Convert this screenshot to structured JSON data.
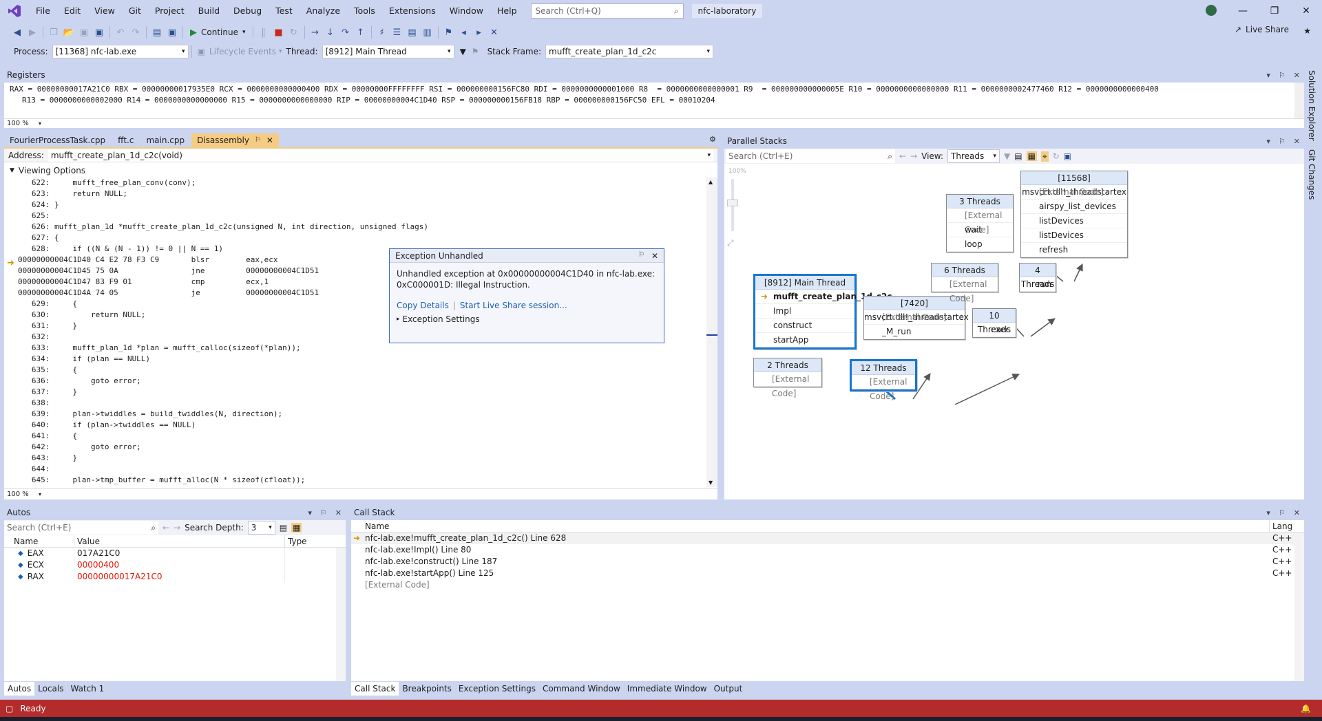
{
  "menu": [
    "File",
    "Edit",
    "View",
    "Git",
    "Project",
    "Build",
    "Debug",
    "Test",
    "Analyze",
    "Tools",
    "Extensions",
    "Window",
    "Help"
  ],
  "search_placeholder": "Search (Ctrl+Q)",
  "solution_name": "nfc-laboratory",
  "live_share": "Live Share",
  "toolbar": {
    "continue_label": "Continue"
  },
  "debug_bar": {
    "process_label": "Process:",
    "process_value": "[11368] nfc-lab.exe",
    "lifecycle_label": "Lifecycle Events",
    "thread_label": "Thread:",
    "thread_value": "[8912] Main Thread",
    "stack_frame_label": "Stack Frame:",
    "stack_frame_value": "mufft_create_plan_1d_c2c"
  },
  "registers": {
    "title": "Registers",
    "line1": "RAX = 00000000017A21C0 RBX = 00000000017935E0 RCX = 0000000000000400 RDX = 00000000FFFFFFFF RSI = 000000000156FC80 RDI = 0000000000001000 R8  = 0000000000000001 R9  = 000000000000005E R10 = 0000000000000000 R11 = 0000000002477460 R12 = 0000000000000400",
    "line2": "R13 = 0000000000002000 R14 = 0000000000000000 R15 = 0000000000000000 RIP = 00000000004C1D40 RSP = 000000000156FB18 RBP = 000000000156FC50 EFL = 00010204",
    "zoom": "100 %"
  },
  "doc_tabs": [
    "FourierProcessTask.cpp",
    "fft.c",
    "main.cpp",
    "Disassembly"
  ],
  "disassembly": {
    "address_label": "Address:",
    "address_value": "mufft_create_plan_1d_c2c(void)",
    "viewing_options": "Viewing Options",
    "zoom": "100 %",
    "lines": [
      "   622:     mufft_free_plan_conv(conv);",
      "   623:     return NULL;",
      "   624: }",
      "   625:",
      "   626: mufft_plan_1d *mufft_create_plan_1d_c2c(unsigned N, int direction, unsigned flags)",
      "   627: {",
      "   628:     if ((N & (N - 1)) != 0 || N == 1)",
      "00000000004C1D40 C4 E2 78 F3 C9       blsr        eax,ecx",
      "00000000004C1D45 75 0A                jne         00000000004C1D51",
      "00000000004C1D47 83 F9 01             cmp         ecx,1",
      "00000000004C1D4A 74 05                je          00000000004C1D51",
      "   629:     {",
      "   630:         return NULL;",
      "   631:     }",
      "   632:",
      "   633:     mufft_plan_1d *plan = mufft_calloc(sizeof(*plan));",
      "   634:     if (plan == NULL)",
      "   635:     {",
      "   636:         goto error;",
      "   637:     }",
      "   638:",
      "   639:     plan->twiddles = build_twiddles(N, direction);",
      "   640:     if (plan->twiddles == NULL)",
      "   641:     {",
      "   642:         goto error;",
      "   643:     }",
      "   644:",
      "   645:     plan->tmp_buffer = mufft_alloc(N * sizeof(cfloat));"
    ]
  },
  "exception": {
    "title": "Exception Unhandled",
    "message1": "Unhandled exception at 0x00000000004C1D40 in nfc-lab.exe:",
    "message2": "0xC000001D: Illegal Instruction.",
    "copy_details": "Copy Details",
    "live_share": "Start Live Share session...",
    "settings": "Exception Settings"
  },
  "parallel_stacks": {
    "title": "Parallel Stacks",
    "search_placeholder": "Search (Ctrl+E)",
    "view_label": "View:",
    "view_value": "Threads",
    "zoom_label": "100%",
    "nodes": {
      "main": {
        "header": "[8912] Main Thread",
        "rows": [
          "mufft_create_plan_1d_c2c",
          "Impl",
          "construct",
          "startApp"
        ]
      },
      "t2": {
        "header": "2 Threads",
        "rows": [
          "[External Code]"
        ]
      },
      "t12": {
        "header": "12 Threads",
        "rows": [
          "[External Code]"
        ]
      },
      "t7420": {
        "header": "[7420] msvcrt.dll!_threadstartex",
        "rows": [
          "[External Code]",
          "_M_run"
        ]
      },
      "t10": {
        "header": "10 Threads",
        "rows": [
          "exec"
        ]
      },
      "t6": {
        "header": "6 Threads",
        "rows": [
          "[External Code]"
        ]
      },
      "t4": {
        "header": "4 Threads",
        "rows": [
          "run"
        ]
      },
      "t3": {
        "header": "3 Threads",
        "rows": [
          "[External Code]",
          "wait",
          "loop"
        ]
      },
      "t11568": {
        "header": "[11568] msvcrt.dll!_threadstartex",
        "rows": [
          "[External Code]",
          "airspy_list_devices",
          "listDevices",
          "listDevices",
          "refresh"
        ]
      }
    }
  },
  "autos": {
    "title": "Autos",
    "search_placeholder": "Search (Ctrl+E)",
    "search_depth_label": "Search Depth:",
    "search_depth_value": "3",
    "columns": [
      "Name",
      "Value",
      "Type"
    ],
    "rows": [
      {
        "name": "EAX",
        "value": "017A21C0",
        "changed": false
      },
      {
        "name": "ECX",
        "value": "00000400",
        "changed": true
      },
      {
        "name": "RAX",
        "value": "00000000017A21C0",
        "changed": true
      }
    ],
    "tabs": [
      "Autos",
      "Locals",
      "Watch 1"
    ]
  },
  "call_stack": {
    "title": "Call Stack",
    "columns": [
      "Name",
      "Lang"
    ],
    "rows": [
      {
        "name": "nfc-lab.exe!mufft_create_plan_1d_c2c() Line 628",
        "lang": "C++"
      },
      {
        "name": "nfc-lab.exe!Impl() Line 80",
        "lang": "C++"
      },
      {
        "name": "nfc-lab.exe!construct() Line 187",
        "lang": "C++"
      },
      {
        "name": "nfc-lab.exe!startApp() Line 125",
        "lang": "C++"
      },
      {
        "name": "[External Code]",
        "lang": ""
      }
    ],
    "tabs": [
      "Call Stack",
      "Breakpoints",
      "Exception Settings",
      "Command Window",
      "Immediate Window",
      "Output"
    ]
  },
  "side_tabs": [
    "Solution Explorer",
    "Git Changes"
  ],
  "status": {
    "text": "Ready"
  },
  "colors": {
    "accent": "#1875d1",
    "status_bar": "#b32b2b",
    "changed_value": "#e51400",
    "active_tab": "#f5cc84"
  }
}
